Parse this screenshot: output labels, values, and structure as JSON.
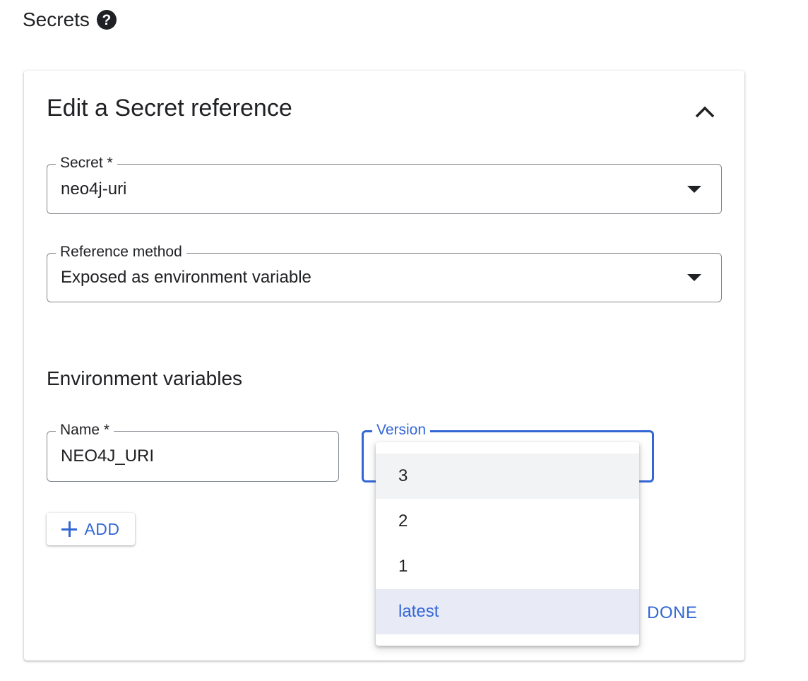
{
  "section": {
    "title": "Secrets",
    "help_icon": "help-circle-icon"
  },
  "card": {
    "title": "Edit a Secret reference",
    "collapse_icon": "chevron-up-icon",
    "secret_field": {
      "label": "Secret *",
      "value": "neo4j-uri"
    },
    "reference_method_field": {
      "label": "Reference method",
      "value": "Exposed as environment variable"
    },
    "env_heading": "Environment variables",
    "name_field": {
      "label": "Name *",
      "value": "NEO4J_URI"
    },
    "version_field": {
      "label": "Version",
      "value": ""
    },
    "add_button": {
      "label": "ADD",
      "icon": "plus-icon"
    },
    "done_button": {
      "label": "DONE"
    }
  },
  "version_menu": {
    "options": [
      {
        "label": "3"
      },
      {
        "label": "2"
      },
      {
        "label": "1"
      },
      {
        "label": "latest"
      }
    ]
  },
  "colors": {
    "accent": "#3367d6",
    "text": "#202124",
    "border": "#80868b"
  }
}
